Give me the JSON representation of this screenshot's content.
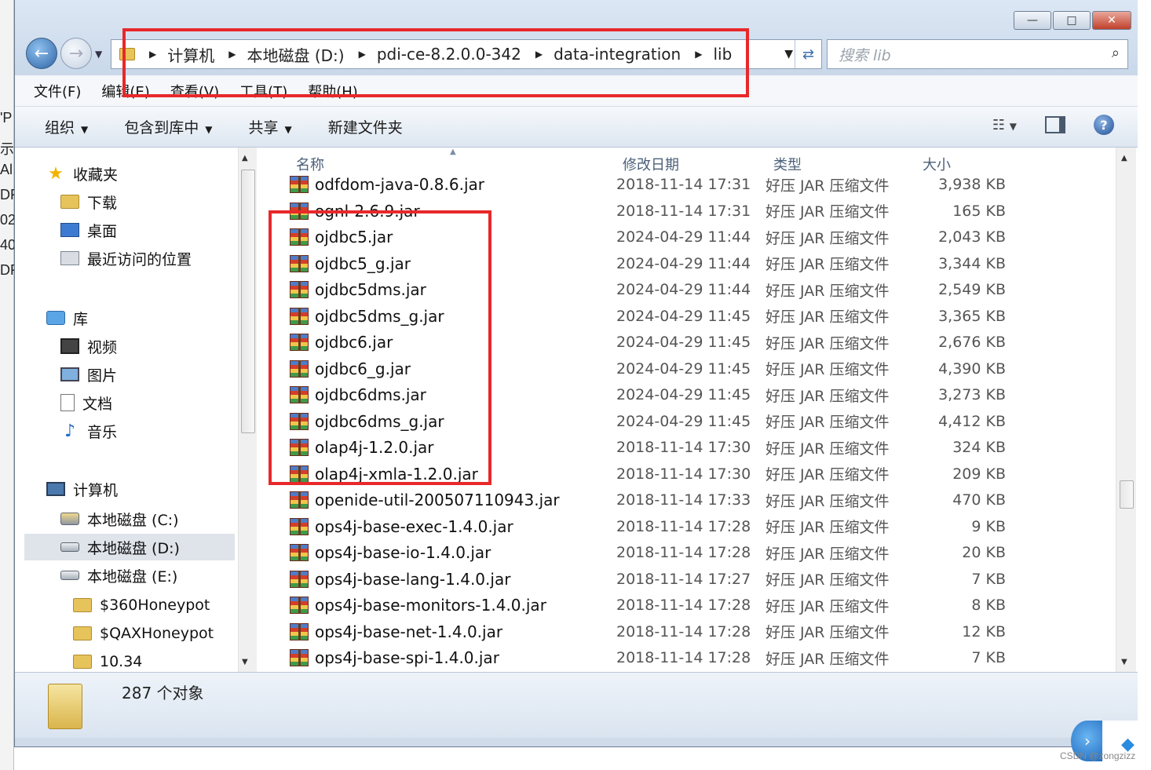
{
  "window": {
    "minimize_glyph": "—",
    "maximize_glyph": "□",
    "close_glyph": "✕"
  },
  "address": {
    "crumbs": [
      "计算机",
      "本地磁盘 (D:)",
      "pdi-ce-8.2.0.0-342",
      "data-integration",
      "lib"
    ]
  },
  "search": {
    "placeholder": "搜索 lib"
  },
  "menu": [
    "文件(F)",
    "编辑(E)",
    "查看(V)",
    "工具(T)",
    "帮助(H)"
  ],
  "toolbar": {
    "organize": "组织",
    "include_in_library": "包含到库中",
    "share": "共享",
    "new_folder": "新建文件夹"
  },
  "nav": {
    "favorites": "收藏夹",
    "downloads": "下载",
    "desktop": "桌面",
    "recent": "最近访问的位置",
    "libraries": "库",
    "videos": "视频",
    "pictures": "图片",
    "documents": "文档",
    "music": "音乐",
    "computer": "计算机",
    "drive_c": "本地磁盘 (C:)",
    "drive_d": "本地磁盘 (D:)",
    "drive_e": "本地磁盘 (E:)",
    "folder1": "$360Honeypot",
    "folder2": "$QAXHoneypot",
    "folder3": "10.34"
  },
  "columns": {
    "name": "名称",
    "date": "修改日期",
    "type": "类型",
    "size": "大小"
  },
  "files": [
    {
      "name": "odfdom-java-0.8.6.jar",
      "date": "2018-11-14 17:31",
      "type": "好压 JAR 压缩文件",
      "size": "3,938 KB"
    },
    {
      "name": "ognl-2.6.9.jar",
      "date": "2018-11-14 17:31",
      "type": "好压 JAR 压缩文件",
      "size": "165 KB"
    },
    {
      "name": "ojdbc5.jar",
      "date": "2024-04-29 11:44",
      "type": "好压 JAR 压缩文件",
      "size": "2,043 KB"
    },
    {
      "name": "ojdbc5_g.jar",
      "date": "2024-04-29 11:44",
      "type": "好压 JAR 压缩文件",
      "size": "3,344 KB"
    },
    {
      "name": "ojdbc5dms.jar",
      "date": "2024-04-29 11:44",
      "type": "好压 JAR 压缩文件",
      "size": "2,549 KB"
    },
    {
      "name": "ojdbc5dms_g.jar",
      "date": "2024-04-29 11:45",
      "type": "好压 JAR 压缩文件",
      "size": "3,365 KB"
    },
    {
      "name": "ojdbc6.jar",
      "date": "2024-04-29 11:45",
      "type": "好压 JAR 压缩文件",
      "size": "2,676 KB"
    },
    {
      "name": "ojdbc6_g.jar",
      "date": "2024-04-29 11:45",
      "type": "好压 JAR 压缩文件",
      "size": "4,390 KB"
    },
    {
      "name": "ojdbc6dms.jar",
      "date": "2024-04-29 11:45",
      "type": "好压 JAR 压缩文件",
      "size": "3,273 KB"
    },
    {
      "name": "ojdbc6dms_g.jar",
      "date": "2024-04-29 11:45",
      "type": "好压 JAR 压缩文件",
      "size": "4,412 KB"
    },
    {
      "name": "olap4j-1.2.0.jar",
      "date": "2018-11-14 17:30",
      "type": "好压 JAR 压缩文件",
      "size": "324 KB"
    },
    {
      "name": "olap4j-xmla-1.2.0.jar",
      "date": "2018-11-14 17:30",
      "type": "好压 JAR 压缩文件",
      "size": "209 KB"
    },
    {
      "name": "openide-util-200507110943.jar",
      "date": "2018-11-14 17:33",
      "type": "好压 JAR 压缩文件",
      "size": "470 KB"
    },
    {
      "name": "ops4j-base-exec-1.4.0.jar",
      "date": "2018-11-14 17:28",
      "type": "好压 JAR 压缩文件",
      "size": "9 KB"
    },
    {
      "name": "ops4j-base-io-1.4.0.jar",
      "date": "2018-11-14 17:28",
      "type": "好压 JAR 压缩文件",
      "size": "20 KB"
    },
    {
      "name": "ops4j-base-lang-1.4.0.jar",
      "date": "2018-11-14 17:27",
      "type": "好压 JAR 压缩文件",
      "size": "7 KB"
    },
    {
      "name": "ops4j-base-monitors-1.4.0.jar",
      "date": "2018-11-14 17:28",
      "type": "好压 JAR 压缩文件",
      "size": "8 KB"
    },
    {
      "name": "ops4j-base-net-1.4.0.jar",
      "date": "2018-11-14 17:28",
      "type": "好压 JAR 压缩文件",
      "size": "12 KB"
    },
    {
      "name": "ops4j-base-spi-1.4.0.jar",
      "date": "2018-11-14 17:28",
      "type": "好压 JAR 压缩文件",
      "size": "7 KB"
    }
  ],
  "status": {
    "count_text": "287 个对象"
  },
  "watermark": "CSDN @zongzizz",
  "colors": {
    "highlight": "#e8282a",
    "selected_nav": "#dfe4ea"
  }
}
